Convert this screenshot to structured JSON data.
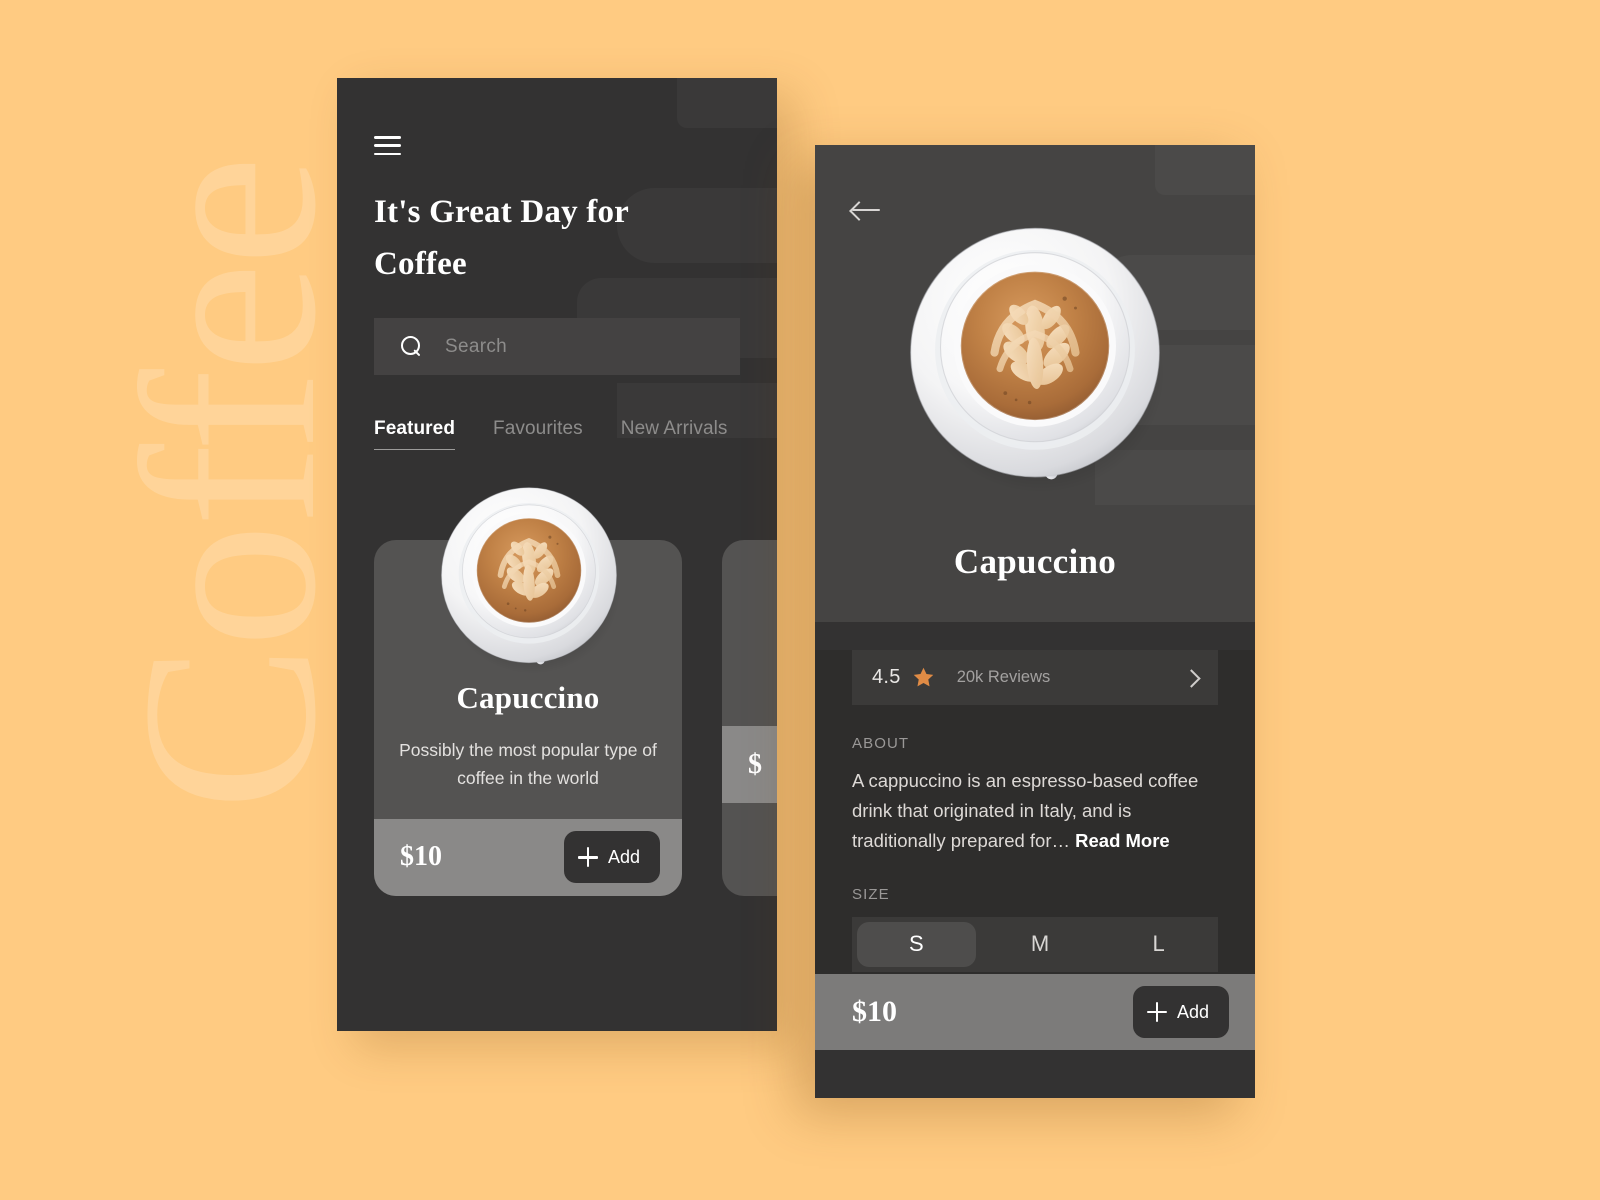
{
  "background": {
    "color": "#FFCB82",
    "watermark_text": "Coffee"
  },
  "home_screen": {
    "menu_icon": "hamburger-menu-icon",
    "title": "It's Great Day for Coffee",
    "search": {
      "icon": "search-icon",
      "placeholder": "Search",
      "value": ""
    },
    "tabs": [
      {
        "label": "Featured",
        "active": true
      },
      {
        "label": "Favourites",
        "active": false
      },
      {
        "label": "New Arrivals",
        "active": false
      }
    ],
    "products": [
      {
        "name": "Capuccino",
        "description": "Possibly the most popular type of coffee in the world",
        "price": "$10",
        "add_label": "Add",
        "add_icon": "plus-icon",
        "image": "coffee-cup-top-view"
      },
      {
        "name": "",
        "description": "",
        "price": "$",
        "add_label": "",
        "add_icon": "plus-icon",
        "image": "coffee-cup-top-view"
      }
    ]
  },
  "detail_screen": {
    "back_icon": "arrow-left-icon",
    "hero_image": "coffee-cup-top-view",
    "product_name": "Capuccino",
    "rating": {
      "value": "4.5",
      "star_icon": "star-icon",
      "star_color": "#E08B45",
      "reviews": "20k Reviews",
      "chevron_icon": "chevron-right-icon"
    },
    "about": {
      "label": "ABOUT",
      "text": "A cappuccino is an espresso-based coffee drink that originated in Italy, and is traditionally prepared for…",
      "read_more": "Read More"
    },
    "size": {
      "label": "SIZE",
      "options": [
        "S",
        "M",
        "L"
      ],
      "selected": "S"
    },
    "footer": {
      "price": "$10",
      "add_label": "Add",
      "add_icon": "plus-icon"
    }
  }
}
